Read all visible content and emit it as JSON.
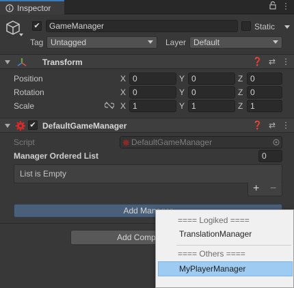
{
  "tab": {
    "title": "Inspector"
  },
  "gameobject": {
    "active": true,
    "name": "GameManager",
    "static_label": "Static",
    "tag_label": "Tag",
    "tag_value": "Untagged",
    "layer_label": "Layer",
    "layer_value": "Default"
  },
  "transform": {
    "title": "Transform",
    "rows": [
      {
        "label": "Position",
        "x": "0",
        "y": "0",
        "z": "0"
      },
      {
        "label": "Rotation",
        "x": "0",
        "y": "0",
        "z": "0"
      },
      {
        "label": "Scale",
        "x": "1",
        "y": "1",
        "z": "1"
      }
    ],
    "axis_x": "X",
    "axis_y": "Y",
    "axis_z": "Z"
  },
  "component": {
    "title": "DefaultGameManager",
    "enabled": true,
    "script_label": "Script",
    "script_value": "DefaultGameManager",
    "list_label": "Manager Ordered List",
    "list_count": "0",
    "list_empty": "List is Empty",
    "plus": "+",
    "minus": "−",
    "add_manager_label": "Add Manager",
    "add_component_label": "Add Component"
  },
  "popup": {
    "sep1": "==== Logiked ====",
    "item1": "TranslationManager",
    "sep2": "==== Others ====",
    "item2": "MyPlayerManager"
  },
  "colors": {
    "accent": "#3a79bb",
    "selection": "#9dcbf2",
    "add_manager": "#4a5f7a"
  }
}
